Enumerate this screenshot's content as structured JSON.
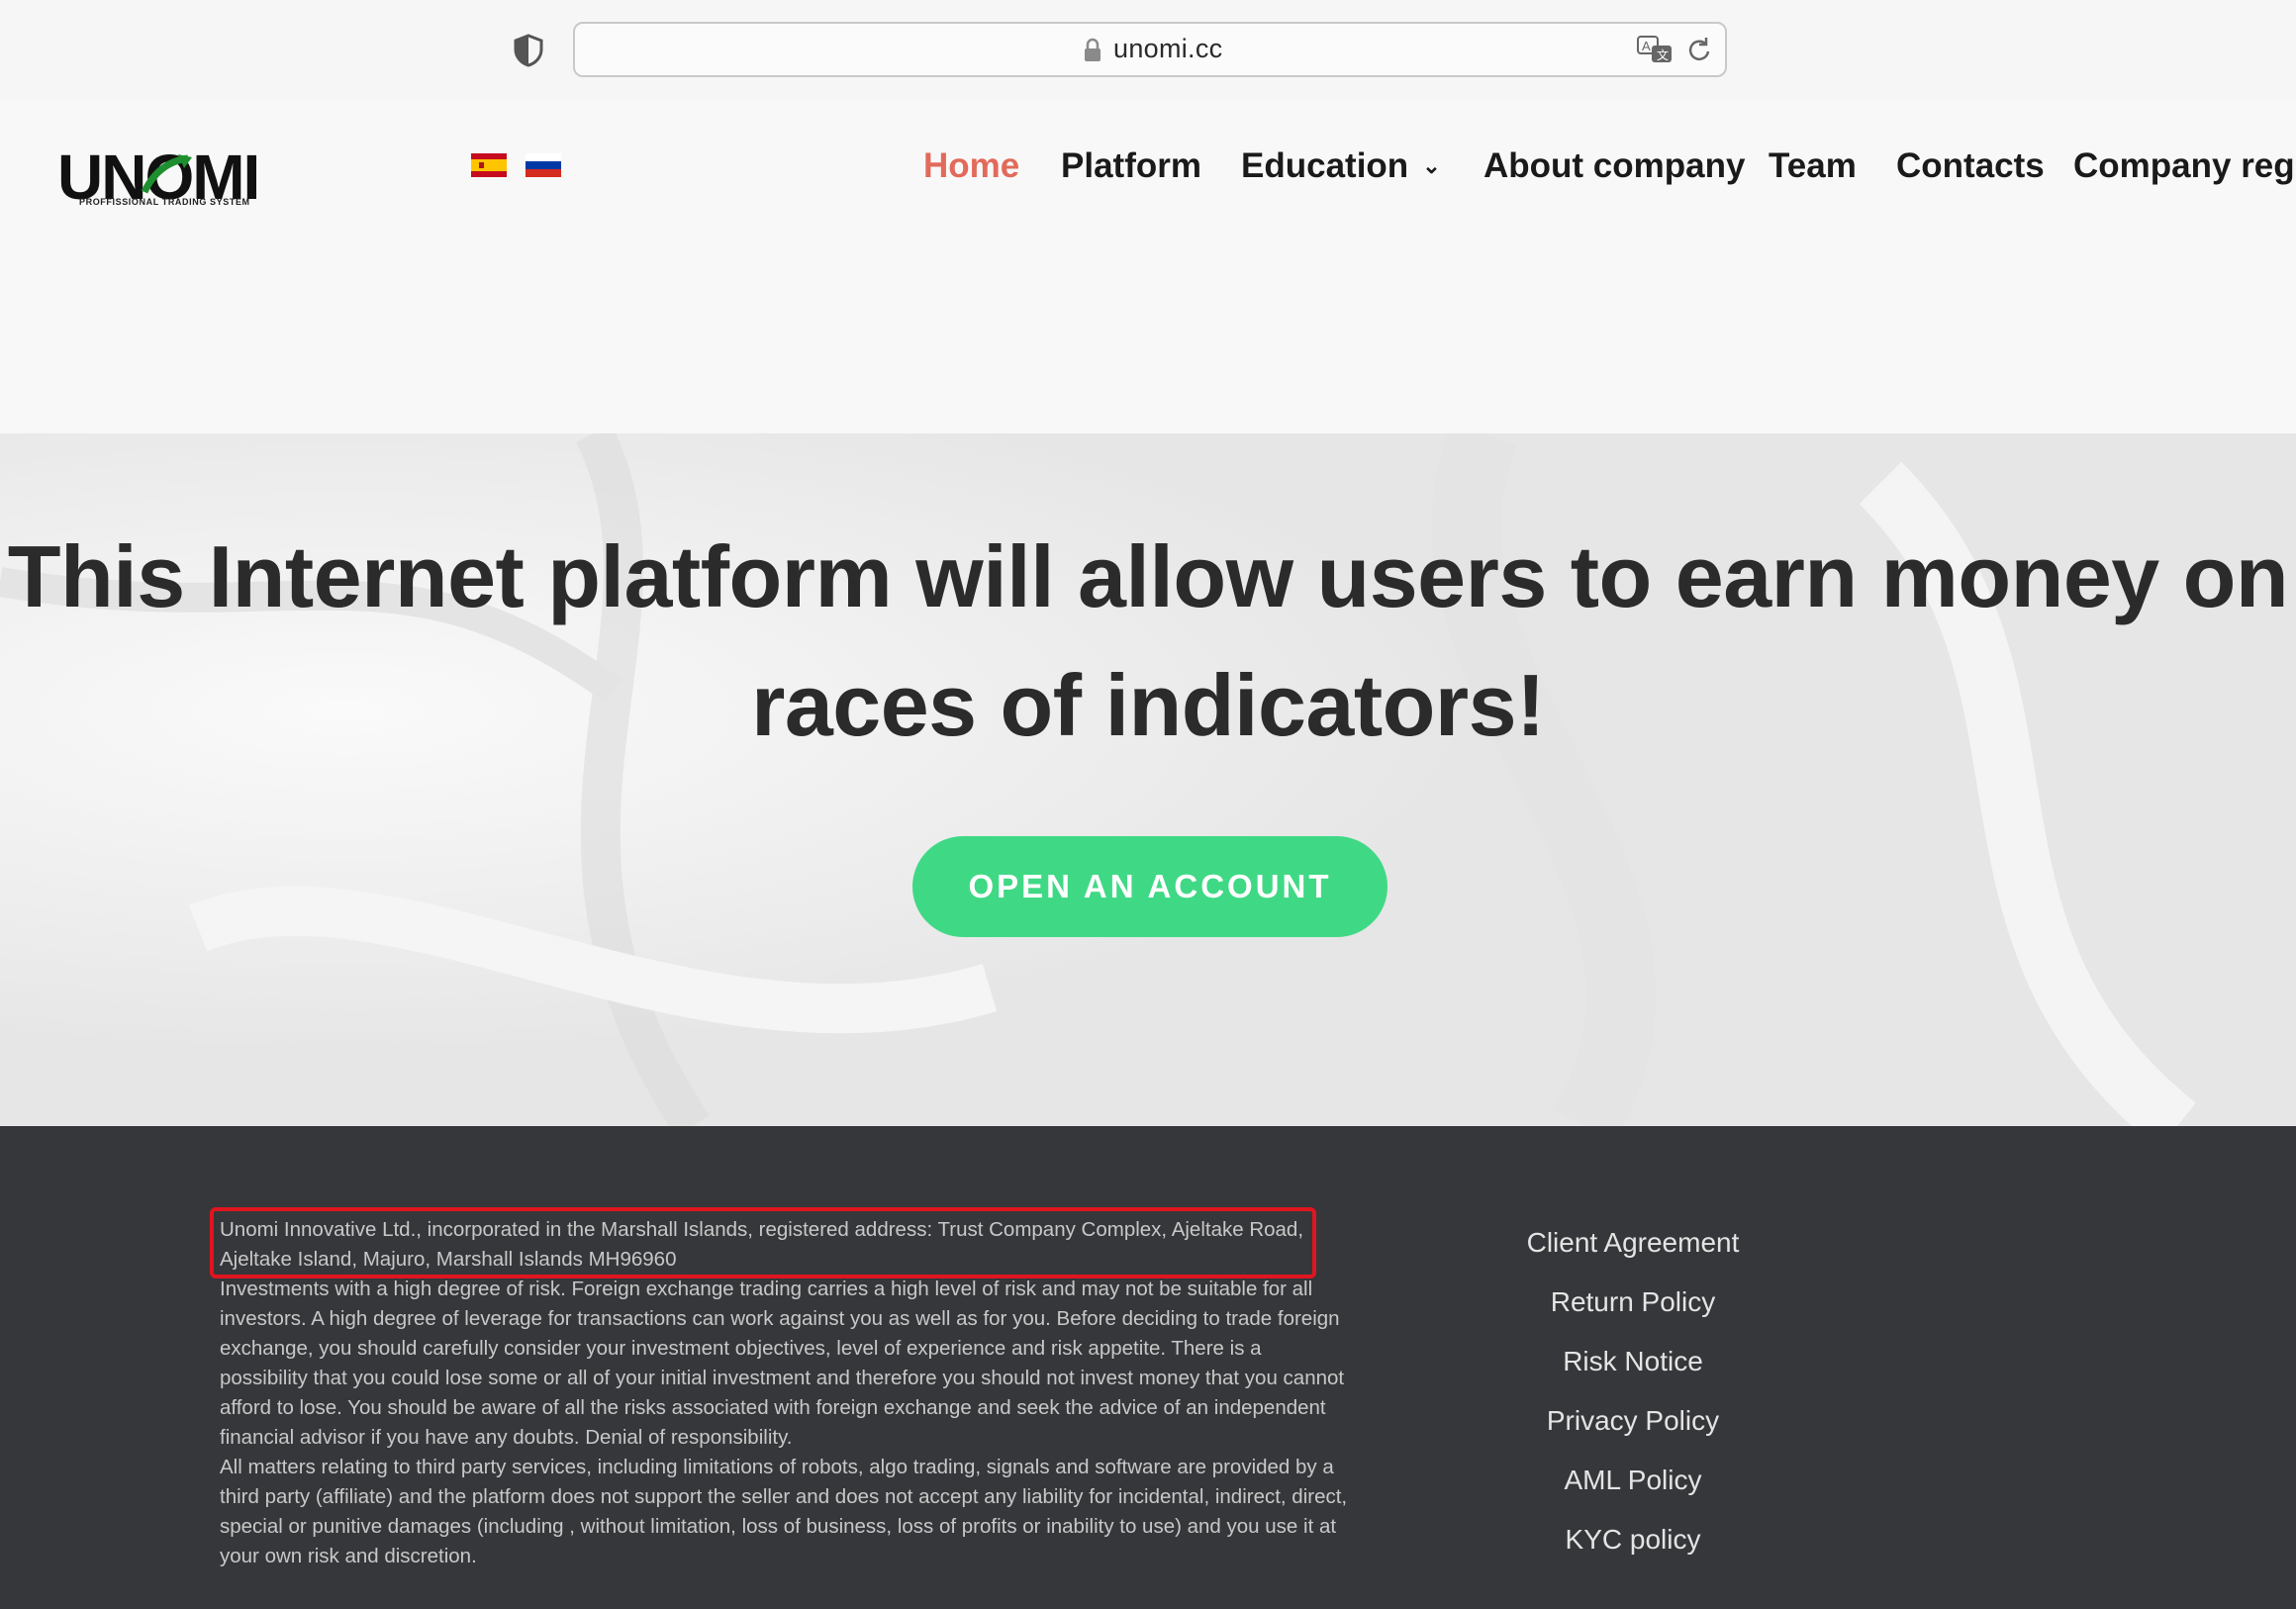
{
  "browser": {
    "url": "unomi.cc"
  },
  "header": {
    "logo_text": "UNOMI",
    "logo_tagline": "PROFFISSIONAL TRADING SYSTEM",
    "languages": [
      "es",
      "ru"
    ],
    "nav": {
      "home": "Home",
      "platform": "Platform",
      "education": "Education",
      "about": "About company",
      "team": "Team",
      "contacts": "Contacts",
      "company_reg": "Company regis"
    },
    "active_nav": "Home"
  },
  "hero": {
    "title_line1": "This Internet platform will allow users to earn money on",
    "title_line2": "races of indicators!",
    "cta_label": "OPEN AN ACCOUNT"
  },
  "footer": {
    "legal_highlighted": "Unomi Innovative Ltd., incorporated in the Marshall Islands, registered address: Trust Company Complex, Ajeltake Road, Ajeltake Island, Majuro, Marshall Islands MH96960",
    "legal_risk": "Investments with a high degree of risk. Foreign exchange trading carries a high level of risk and may not be suitable for all investors. A high degree of leverage for transactions can work against you as well as for you. Before deciding to trade foreign exchange, you should carefully consider your investment objectives, level of experience and risk appetite. There is a possibility that you could lose some or all of your initial investment and therefore you should not invest money that you cannot afford to lose. You should be aware of all the risks associated with foreign exchange and seek the advice of an independent financial advisor if you have any doubts. Denial of responsibility.",
    "legal_thirdparty": "All matters relating to third party services, including limitations of robots, algo trading, signals and software are provided by a third party (affiliate) and the platform does not support the seller and does not accept any liability for incidental, indirect, direct, special or punitive damages (including , without limitation, loss of business, loss of profits or inability to use) and you use it at your own risk and discretion.",
    "links": {
      "client_agreement": "Client Agreement",
      "return_policy": "Return Policy",
      "risk_notice": "Risk Notice",
      "privacy_policy": "Privacy Policy",
      "aml_policy": "AML Policy",
      "kyc_policy": "KYC policy"
    }
  },
  "colors": {
    "accent_nav_active": "#e26a5a",
    "cta_green": "#3fd985",
    "footer_bg": "#36373a",
    "highlight_red": "#e0151f"
  }
}
